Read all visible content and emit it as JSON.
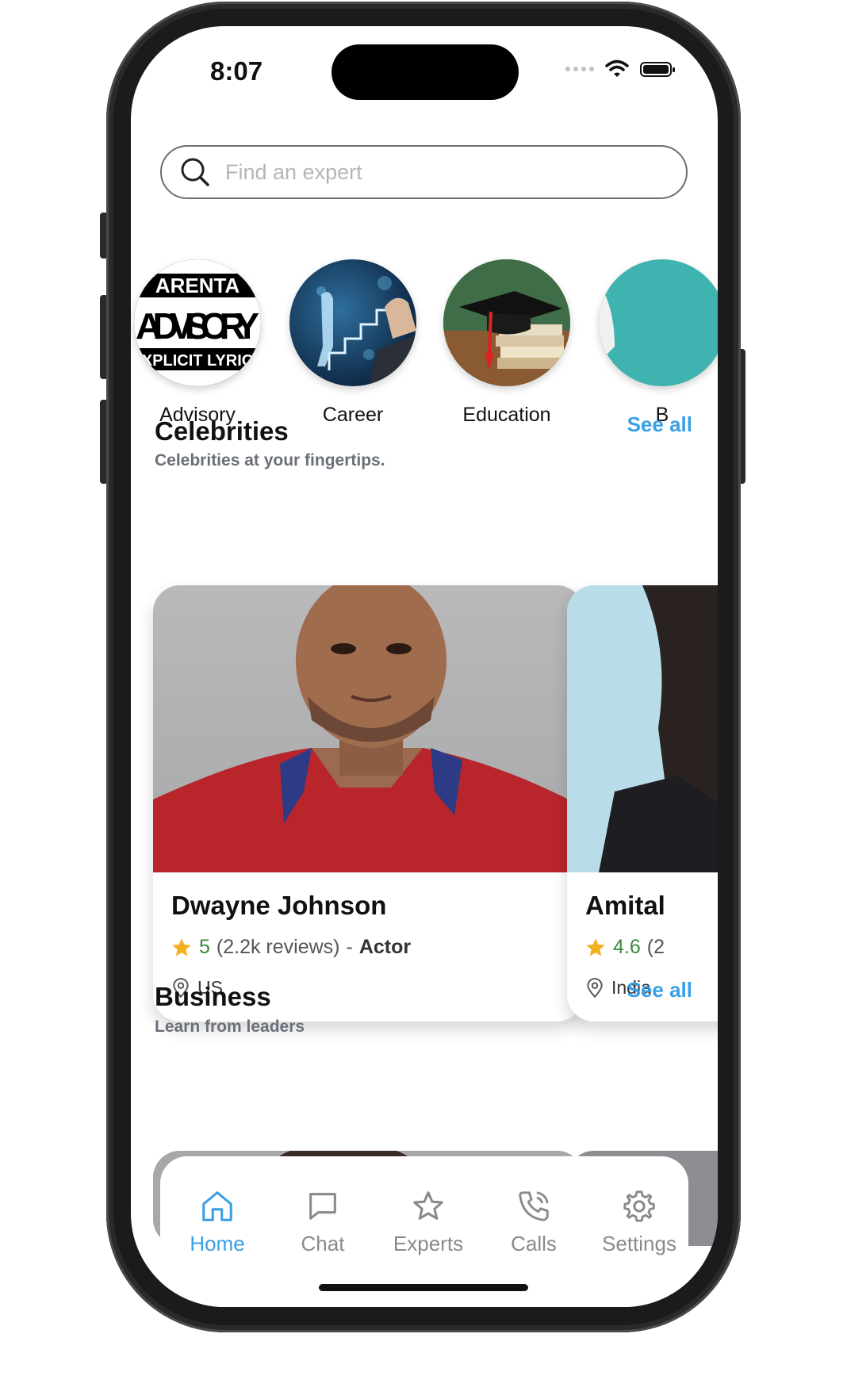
{
  "status_bar": {
    "time": "8:07"
  },
  "search": {
    "placeholder": "Find an expert"
  },
  "categories": [
    {
      "label": "Advisory",
      "badge": [
        "ARENTA",
        "ADVISORY",
        "XPLICIT LYRIC"
      ]
    },
    {
      "label": "Career"
    },
    {
      "label": "Education"
    },
    {
      "label": "B"
    }
  ],
  "celebrities": {
    "title": "Celebrities",
    "subtitle": "Celebrities at your fingertips.",
    "see_all": "See all",
    "cards": [
      {
        "name": "Dwayne Johnson",
        "rating": "5",
        "reviews": "(2.2k reviews)",
        "separator": "-",
        "role": "Actor",
        "location": "US"
      },
      {
        "name": "Amital",
        "rating": "4.6",
        "reviews": "(2",
        "location": "India"
      }
    ]
  },
  "business": {
    "title": "Business",
    "subtitle": "Learn from leaders",
    "see_all": "See all"
  },
  "tabbar": {
    "items": [
      {
        "label": "Home",
        "icon": "home-icon",
        "active": true
      },
      {
        "label": "Chat",
        "icon": "chat-icon"
      },
      {
        "label": "Experts",
        "icon": "star-icon"
      },
      {
        "label": "Calls",
        "icon": "phone-icon"
      },
      {
        "label": "Settings",
        "icon": "gear-icon"
      }
    ]
  },
  "colors": {
    "accent": "#3a9fe6",
    "rating_green": "#3b8a3e",
    "star": "#f2b01e"
  }
}
